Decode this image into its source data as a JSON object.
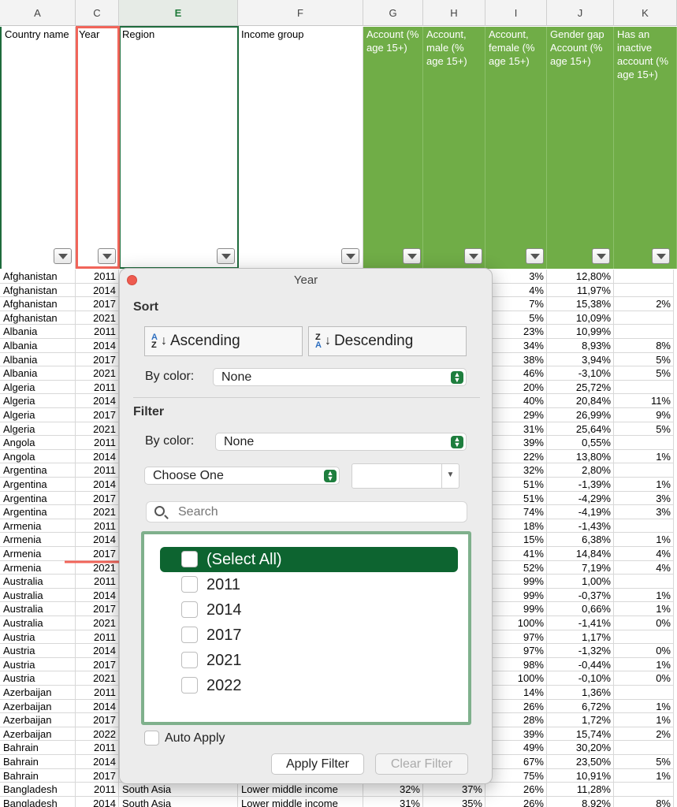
{
  "columns": [
    {
      "letter": "A",
      "title": "Country name"
    },
    {
      "letter": "C",
      "title": "Year"
    },
    {
      "letter": "E",
      "title": "Region"
    },
    {
      "letter": "F",
      "title": "Income group"
    },
    {
      "letter": "G",
      "title": "Account (% age 15+)"
    },
    {
      "letter": "H",
      "title": "Account, male (% age 15+)"
    },
    {
      "letter": "I",
      "title": "Account, female (% age 15+)"
    },
    {
      "letter": "J",
      "title": "Gender gap Account (% age 15+)"
    },
    {
      "letter": "K",
      "title": "Has an inactive account (% age 15+)"
    }
  ],
  "rows": [
    [
      "Afghanistan",
      "2011",
      "",
      "",
      "",
      "",
      "3%",
      "12,80%",
      ""
    ],
    [
      "Afghanistan",
      "2014",
      "",
      "",
      "",
      "",
      "4%",
      "11,97%",
      ""
    ],
    [
      "Afghanistan",
      "2017",
      "",
      "",
      "",
      "",
      "7%",
      "15,38%",
      "2%"
    ],
    [
      "Afghanistan",
      "2021",
      "",
      "",
      "",
      "",
      "5%",
      "10,09%",
      ""
    ],
    [
      "Albania",
      "2011",
      "",
      "",
      "",
      "",
      "23%",
      "10,99%",
      ""
    ],
    [
      "Albania",
      "2014",
      "",
      "",
      "",
      "",
      "34%",
      "8,93%",
      "8%"
    ],
    [
      "Albania",
      "2017",
      "",
      "",
      "",
      "",
      "38%",
      "3,94%",
      "5%"
    ],
    [
      "Albania",
      "2021",
      "",
      "",
      "",
      "",
      "46%",
      "-3,10%",
      "5%"
    ],
    [
      "Algeria",
      "2011",
      "",
      "",
      "",
      "",
      "20%",
      "25,72%",
      ""
    ],
    [
      "Algeria",
      "2014",
      "",
      "",
      "",
      "",
      "40%",
      "20,84%",
      "11%"
    ],
    [
      "Algeria",
      "2017",
      "",
      "",
      "",
      "",
      "29%",
      "26,99%",
      "9%"
    ],
    [
      "Algeria",
      "2021",
      "",
      "",
      "",
      "",
      "31%",
      "25,64%",
      "5%"
    ],
    [
      "Angola",
      "2011",
      "",
      "",
      "",
      "",
      "39%",
      "0,55%",
      ""
    ],
    [
      "Angola",
      "2014",
      "",
      "",
      "",
      "",
      "22%",
      "13,80%",
      "1%"
    ],
    [
      "Argentina",
      "2011",
      "",
      "",
      "",
      "",
      "32%",
      "2,80%",
      ""
    ],
    [
      "Argentina",
      "2014",
      "",
      "",
      "",
      "",
      "51%",
      "-1,39%",
      "1%"
    ],
    [
      "Argentina",
      "2017",
      "",
      "",
      "",
      "",
      "51%",
      "-4,29%",
      "3%"
    ],
    [
      "Argentina",
      "2021",
      "",
      "",
      "",
      "",
      "74%",
      "-4,19%",
      "3%"
    ],
    [
      "Armenia",
      "2011",
      "",
      "",
      "",
      "",
      "18%",
      "-1,43%",
      ""
    ],
    [
      "Armenia",
      "2014",
      "",
      "",
      "",
      "",
      "15%",
      "6,38%",
      "1%"
    ],
    [
      "Armenia",
      "2017",
      "",
      "",
      "",
      "",
      "41%",
      "14,84%",
      "4%"
    ],
    [
      "Armenia",
      "2021",
      "",
      "",
      "",
      "",
      "52%",
      "7,19%",
      "4%"
    ],
    [
      "Australia",
      "2011",
      "",
      "",
      "",
      "",
      "99%",
      "1,00%",
      ""
    ],
    [
      "Australia",
      "2014",
      "",
      "",
      "",
      "",
      "99%",
      "-0,37%",
      "1%"
    ],
    [
      "Australia",
      "2017",
      "",
      "",
      "",
      "",
      "99%",
      "0,66%",
      "1%"
    ],
    [
      "Australia",
      "2021",
      "",
      "",
      "",
      "",
      "100%",
      "-1,41%",
      "0%"
    ],
    [
      "Austria",
      "2011",
      "",
      "",
      "",
      "",
      "97%",
      "1,17%",
      ""
    ],
    [
      "Austria",
      "2014",
      "",
      "",
      "",
      "",
      "97%",
      "-1,32%",
      "0%"
    ],
    [
      "Austria",
      "2017",
      "",
      "",
      "",
      "",
      "98%",
      "-0,44%",
      "1%"
    ],
    [
      "Austria",
      "2021",
      "",
      "",
      "",
      "",
      "100%",
      "-0,10%",
      "0%"
    ],
    [
      "Azerbaijan",
      "2011",
      "",
      "",
      "",
      "",
      "14%",
      "1,36%",
      ""
    ],
    [
      "Azerbaijan",
      "2014",
      "",
      "",
      "",
      "",
      "26%",
      "6,72%",
      "1%"
    ],
    [
      "Azerbaijan",
      "2017",
      "",
      "",
      "",
      "",
      "28%",
      "1,72%",
      "1%"
    ],
    [
      "Azerbaijan",
      "2022",
      "",
      "",
      "",
      "",
      "39%",
      "15,74%",
      "2%"
    ],
    [
      "Bahrain",
      "2011",
      "",
      "",
      "",
      "",
      "49%",
      "30,20%",
      ""
    ],
    [
      "Bahrain",
      "2014",
      "",
      "",
      "",
      "",
      "67%",
      "23,50%",
      "5%"
    ],
    [
      "Bahrain",
      "2017",
      "",
      "",
      "",
      "",
      "75%",
      "10,91%",
      "1%"
    ],
    [
      "Bangladesh",
      "2011",
      "South Asia",
      "Lower middle income",
      "32%",
      "37%",
      "26%",
      "11,28%",
      ""
    ],
    [
      "Bangladesh",
      "2014",
      "South Asia",
      "Lower middle income",
      "31%",
      "35%",
      "26%",
      "8,92%",
      "8%"
    ]
  ],
  "popup": {
    "title": "Year",
    "sort_label": "Sort",
    "ascending": "Ascending",
    "descending": "Descending",
    "by_color": "By color:",
    "sort_color_value": "None",
    "filter_label": "Filter",
    "filter_color_value": "None",
    "condition": "Choose One",
    "condition_value": "",
    "search_placeholder": "Search",
    "items": [
      "(Select All)",
      "2011",
      "2014",
      "2017",
      "2021",
      "2022"
    ],
    "auto_apply": "Auto Apply",
    "apply": "Apply Filter",
    "clear": "Clear Filter"
  },
  "colors": {
    "header_green": "#70ad47",
    "selection_green": "#0d6430",
    "highlight_red": "#f1655a"
  }
}
